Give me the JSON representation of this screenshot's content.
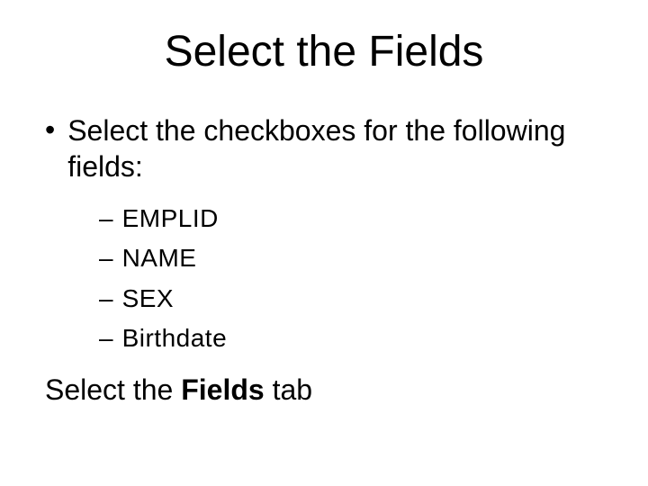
{
  "title": "Select the Fields",
  "main_bullet": "Select the checkboxes for the following fields:",
  "fields": {
    "0": "EMPLID",
    "1": "NAME",
    "2": "SEX",
    "3": "Birthdate"
  },
  "footer": {
    "prefix": "Select the ",
    "bold": "Fields",
    "suffix": " tab"
  },
  "symbols": {
    "bullet": "•",
    "dash": "–"
  }
}
